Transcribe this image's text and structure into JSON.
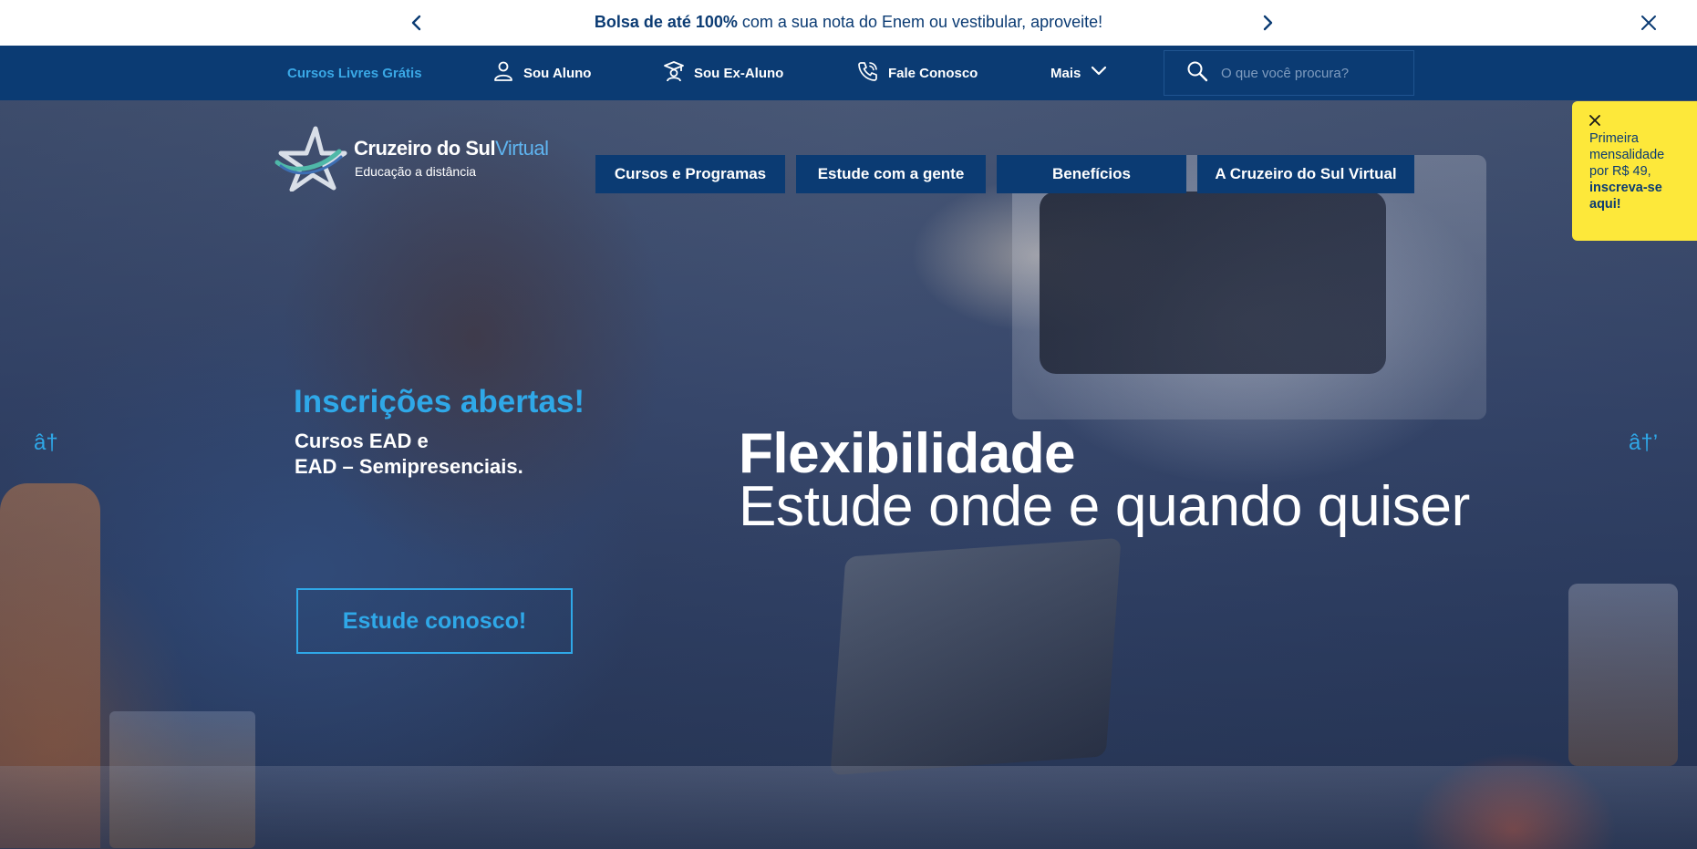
{
  "announcement": {
    "bold": "Bolsa de até 100%",
    "rest": " com a sua nota do Enem ou vestibular, aproveite!"
  },
  "utility_nav": {
    "free_courses": "Cursos Livres Grátis",
    "student": "Sou Aluno",
    "alumni": "Sou Ex-Aluno",
    "contact": "Fale Conosco",
    "more": "Mais",
    "search_placeholder": "O que você procura?"
  },
  "logo": {
    "name_main": "Cruzeiro do Sul",
    "name_accent": "Virtual",
    "tagline": "Educação a distância"
  },
  "main_nav": {
    "items": [
      "Cursos e Programas",
      "Estude com a gente",
      "Benefícios",
      "A Cruzeiro do Sul Virtual"
    ]
  },
  "promo": {
    "close_icon": "close-icon",
    "text": "Primeira mensalidade por R$ 49,",
    "link": "inscreva-se aqui!"
  },
  "carousel": {
    "prev_glyph": "â†",
    "next_glyph": "â†’"
  },
  "hero": {
    "headline": "Inscrições abertas!",
    "sub_line1": "Cursos EAD e",
    "sub_line2": "EAD – Semipresenciais.",
    "cta": "Estude conosco!",
    "big_bold": "Flexibilidade",
    "big_regular": "Estude onde e quando quiser"
  },
  "colors": {
    "navy": "#0b3b73",
    "accent_blue": "#2fa8e8",
    "promo_yellow": "#fde83a"
  }
}
